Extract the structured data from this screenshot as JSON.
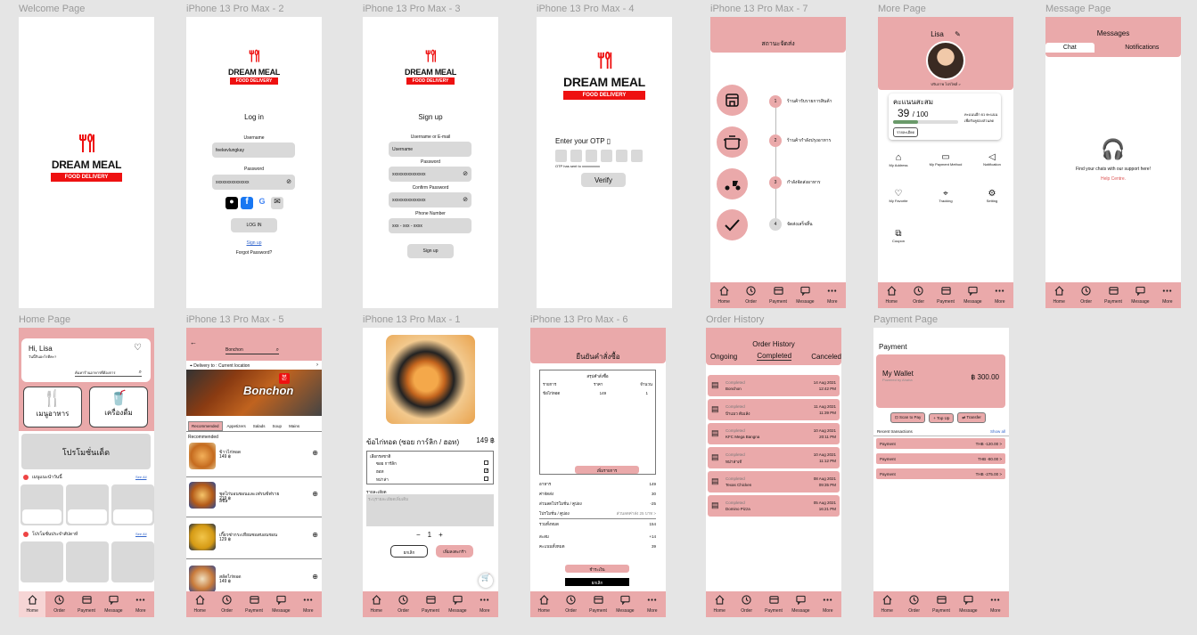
{
  "labels": {
    "welcome": "Welcome Page",
    "login": "iPhone 13 Pro Max - 2",
    "signup": "iPhone 13 Pro Max - 3",
    "otp": "iPhone 13 Pro Max - 4",
    "status": "iPhone 13 Pro Max - 7",
    "more": "More Page",
    "message": "Message Page",
    "home": "Home Page",
    "restaurant": "iPhone 13 Pro Max - 5",
    "product": "iPhone 13 Pro Max - 1",
    "confirm": "iPhone 13 Pro Max - 6",
    "history": "Order History",
    "payment": "Payment Page"
  },
  "brand": {
    "name": "DREAM MEAL",
    "tag": "FOOD DELIVERY",
    "accent": "#eaa9aa",
    "red": "#ee1111"
  },
  "nav": [
    "Home",
    "Order",
    "Payment",
    "Message",
    "More"
  ],
  "login": {
    "title": "Log in",
    "user_label": "Username",
    "user_value": "feekevlungkay",
    "pass_label": "Password",
    "pass_value": "xxxxxxxxxxxxxxx",
    "btn": "LOG IN",
    "signup": "Sign up",
    "forgot": "Forgot Password?"
  },
  "signup": {
    "title": "Sign up",
    "user_label": "Username or E-mail",
    "user_value": "Username",
    "pass_label": "Password",
    "pass_value": "xxxxxxxxxxxxxxx",
    "confirm_label": "Confirm Password",
    "confirm_value": "xxxxxxxxxxxxxxx",
    "phone_label": "Phone Number",
    "phone_value": "xxx - xxx - xxxx",
    "btn": "Sign up"
  },
  "otp": {
    "title": "Enter your OTP",
    "note": "OTP has sent to xxxxxxxxxx",
    "btn": "Verify"
  },
  "status": {
    "title": "สถานะจัดส่ง",
    "steps": [
      {
        "n": "1",
        "t": "ร้านค้ารับรายการสินค้า"
      },
      {
        "n": "2",
        "t": "ร้านค้ากำลังปรุงอาหาร"
      },
      {
        "n": "3",
        "t": "กำลังจัดส่งอาหาร"
      },
      {
        "n": "4",
        "t": "จัดส่งเสร็จสิ้น"
      }
    ]
  },
  "more": {
    "name": "Lisa",
    "sub": "ปรับภาพ โปรไฟล์ >",
    "points_title": "คะแนนสะสม",
    "points": "39",
    "points_total": "/ 100",
    "points_note": "คะแนนอีก 61 คะแนน เพื่อรับคูปองส่วนลด",
    "points_btn": "รายละเอียด",
    "items": [
      "My Address",
      "My Payment Method",
      "Notification",
      "My Favorite",
      "Tracking",
      "Setting",
      "Coupon"
    ]
  },
  "message": {
    "title": "Messages",
    "tab1": "Chat",
    "tab2": "Notifications",
    "text": "Find your chats with our support here!",
    "link": "Help Centre."
  },
  "home": {
    "greet": "Hi, Lisa",
    "sub": "วันนี้กินอะไรดีคะ?",
    "search": "ค้นหาร้านอาหารที่ต้องการ",
    "cat1": "เมนูอาหาร",
    "cat2": "เครื่องดื่ม",
    "promo": "โปรโมชั่นเด็ด",
    "sec1": "เมนูแนะนำวันนี้",
    "sec2": "โปรโมชั่นประจำสัปดาห์",
    "see_all": "See All"
  },
  "restaurant": {
    "search": "Bonchon",
    "delivery": "Delivery to : Current location",
    "banner": "Bonchon",
    "tabs": [
      "Recommended",
      "Appetizers",
      "Salads",
      "Soup",
      "Mains"
    ],
    "section": "Recommended",
    "items": [
      {
        "name": "ข้าวไก่ทอด",
        "price": "149 ฿"
      },
      {
        "name": "ชุดไก่บอนชอนและเฟรนช์ฟรายส์ชีส",
        "price": "219 ฿"
      },
      {
        "name": "เกี๊ยวซ่ากระเทียมซอสบอนชอน",
        "price": "129 ฿"
      },
      {
        "name": "สลัดไก่ทอด",
        "price": "149 ฿"
      }
    ]
  },
  "product": {
    "name": "ข้อไก่ทอด (ซอย การ์ลิก / ฮอท)",
    "price": "149 ฿",
    "opt_title": "เลือกรสชาติ",
    "opts": [
      "ซอย การ์ลิก",
      "ฮอท",
      "หม่าล่า"
    ],
    "note_label": "รายละเอียด",
    "note_ph": "ระบุรายละเอียดเพิ่มเติม",
    "qty": "1",
    "cancel": "ยกเลิก",
    "add": "เพิ่มลงตะกร้า"
  },
  "confirm": {
    "title": "ยืนยันคำสั่งซื้อ",
    "summary": "สรุปคำสั่งซื้อ",
    "h1": "รายการ",
    "h2": "ราคา",
    "h3": "จำนวน",
    "item": "ข้อไก่ทอด",
    "item_price": "149",
    "item_qty": "1",
    "add_btn": "เพิ่มรายการ",
    "rows": [
      {
        "l": "อาหาร",
        "v": "149"
      },
      {
        "l": "ค่าจัดส่ง",
        "v": "30"
      },
      {
        "l": "ส่วนลดโปรโมชั่น / คูปอง",
        "v": "-25"
      },
      {
        "l": "โปรโมชั่น / คูปอง",
        "v": "ส่วนลดค่าส่ง 25 บาท >"
      },
      {
        "l": "รวมทั้งหมด",
        "v": "154"
      }
    ],
    "pts1_l": "สะสม",
    "pts1_v": "+14",
    "pts2_l": "คะแนนทั้งหมด",
    "pts2_v": "39",
    "btn1": "ชำระเงิน",
    "btn2": "ยกเลิก"
  },
  "history": {
    "title": "Order History",
    "tabs": [
      "Ongoing",
      "Completed",
      "Canceled"
    ],
    "orders": [
      {
        "s": "Completed",
        "n": "Bonchon",
        "d": "14 Aug 2021",
        "t": "12:42 PM"
      },
      {
        "s": "Completed",
        "n": "ป้าแมว ต้มเล้ง",
        "d": "11 Aug 2021",
        "t": "11:39 PM"
      },
      {
        "s": "Completed",
        "n": "KFC Mega Bangna",
        "d": "10 Aug 2021",
        "t": "20:11 PM"
      },
      {
        "s": "Completed",
        "n": "หม่าล่าเจ๊",
        "d": "10 Aug 2021",
        "t": "11:12 PM"
      },
      {
        "s": "Completed",
        "n": "Texas Chicken",
        "d": "08 Aug 2021",
        "t": "09:35 PM"
      },
      {
        "s": "Completed",
        "n": "Domino Pizza",
        "d": "05 Aug 2021",
        "t": "16:21 PM"
      }
    ]
  },
  "payment": {
    "title": "Payment",
    "wallet": "My Wallet",
    "wallet_sub": "Powered by Ahaha",
    "balance": "฿ 300.00",
    "actions": [
      "Scan to Pay",
      "Top Up",
      "Transfer"
    ],
    "recent": "Recent transactions",
    "show_all": "Show all",
    "tx": [
      {
        "l": "Payment",
        "v": "THB -120.00 >"
      },
      {
        "l": "Payment",
        "v": "THB -80.00 >"
      },
      {
        "l": "Payment",
        "v": "THB -275.00 >"
      }
    ]
  }
}
